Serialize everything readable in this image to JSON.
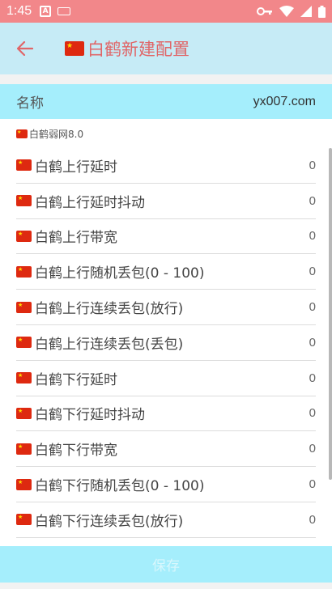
{
  "status_bar": {
    "time": "1:45",
    "left_icons": [
      "app-a-icon",
      "keyboard-icon"
    ],
    "right_icons": [
      "vpn-key-icon",
      "wifi-icon",
      "signal-icon",
      "battery-icon"
    ]
  },
  "toolbar": {
    "title": "白鹤新建配置",
    "back_icon": "arrow-left-icon"
  },
  "name_field": {
    "label": "名称",
    "value": "yx007.com"
  },
  "section": {
    "subtitle": "白鹤弱网8.0"
  },
  "rows": [
    {
      "label": "白鹤上行延时",
      "value": "0"
    },
    {
      "label": "白鹤上行延时抖动",
      "value": "0"
    },
    {
      "label": "白鹤上行带宽",
      "value": "0"
    },
    {
      "label": "白鹤上行随机丢包(0 - 100)",
      "value": "0"
    },
    {
      "label": "白鹤上行连续丢包(放行)",
      "value": "0"
    },
    {
      "label": "白鹤上行连续丢包(丢包)",
      "value": "0"
    },
    {
      "label": "白鹤下行延时",
      "value": "0"
    },
    {
      "label": "白鹤下行延时抖动",
      "value": "0"
    },
    {
      "label": "白鹤下行带宽",
      "value": "0"
    },
    {
      "label": "白鹤下行随机丢包(0 - 100)",
      "value": "0"
    },
    {
      "label": "白鹤下行连续丢包(放行)",
      "value": "0"
    }
  ],
  "footer": {
    "save_label": "保存"
  },
  "colors": {
    "status_bar": "#f2878a",
    "toolbar": "#c6ebf6",
    "accent_red": "#e06668",
    "cyan_bar": "#a5eefc"
  }
}
